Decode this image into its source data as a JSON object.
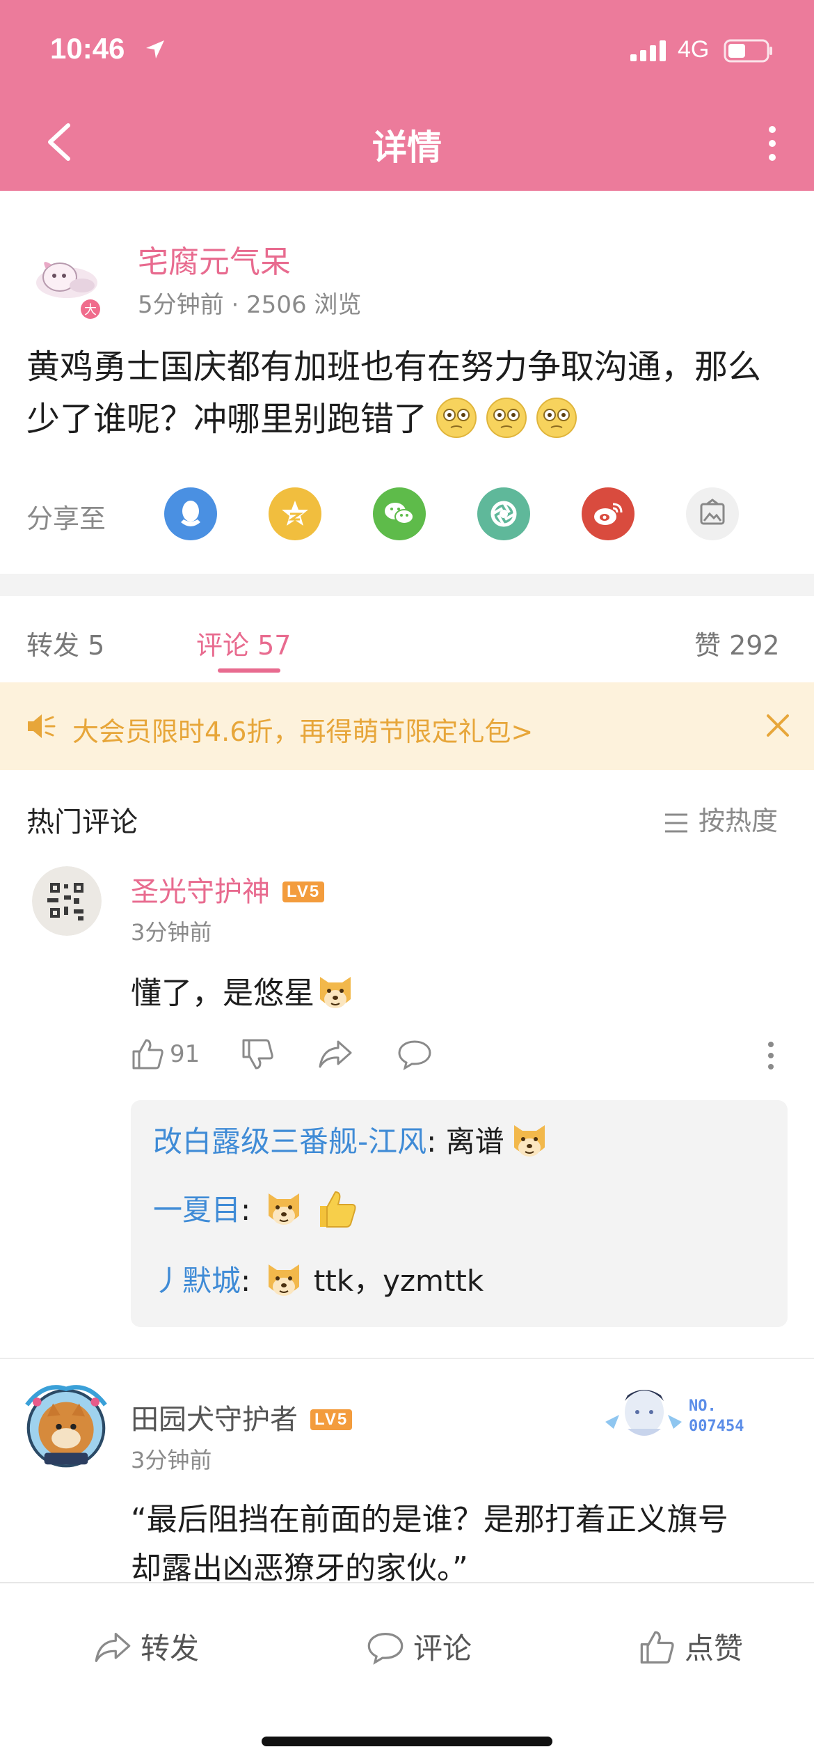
{
  "status_bar": {
    "time": "10:46",
    "network": "4G"
  },
  "header": {
    "title": "详情"
  },
  "post": {
    "author": "宅腐元气呆",
    "meta": "5分钟前 · 2506 浏览",
    "text": "黄鸡勇士国庆都有加班也有在努力争取沟通，那么少了谁呢？冲哪里别跑错了",
    "share_label": "分享至"
  },
  "tabs": {
    "repost": "转发  5",
    "comments": "评论  57",
    "likes": "赞  292"
  },
  "banner": {
    "text": "大会员限时4.6折，再得萌节限定礼包>"
  },
  "hot_comments": {
    "title": "热门评论",
    "sort": "按热度"
  },
  "comments": [
    {
      "name": "圣光守护神",
      "level": "LV5",
      "time": "3分钟前",
      "text": "懂了，是悠星",
      "likes": "91",
      "replies": [
        {
          "user": "改白露级三番舰-江风",
          "text": " 离谱"
        },
        {
          "user": "一夏目",
          "text": ""
        },
        {
          "user": "丿默城",
          "text": " ttk，yzmttk"
        }
      ]
    },
    {
      "name": "田园犬守护者",
      "level": "LV5",
      "time": "3分钟前",
      "badge": "NO.\n007454",
      "text_line1": "“最后阻挡在前面的是谁？是那打着正义旗号",
      "text_line2": "却露出凶恶獠牙的家伙。”"
    }
  ],
  "bottom_bar": {
    "repost": "转发",
    "comment": "评论",
    "like": "点赞"
  },
  "colors": {
    "accent": "#ec7b9b",
    "pink_text": "#e86b8f",
    "link_blue": "#3f8bd6",
    "banner_bg": "#fdf2dc",
    "banner_text": "#e7a63a"
  }
}
